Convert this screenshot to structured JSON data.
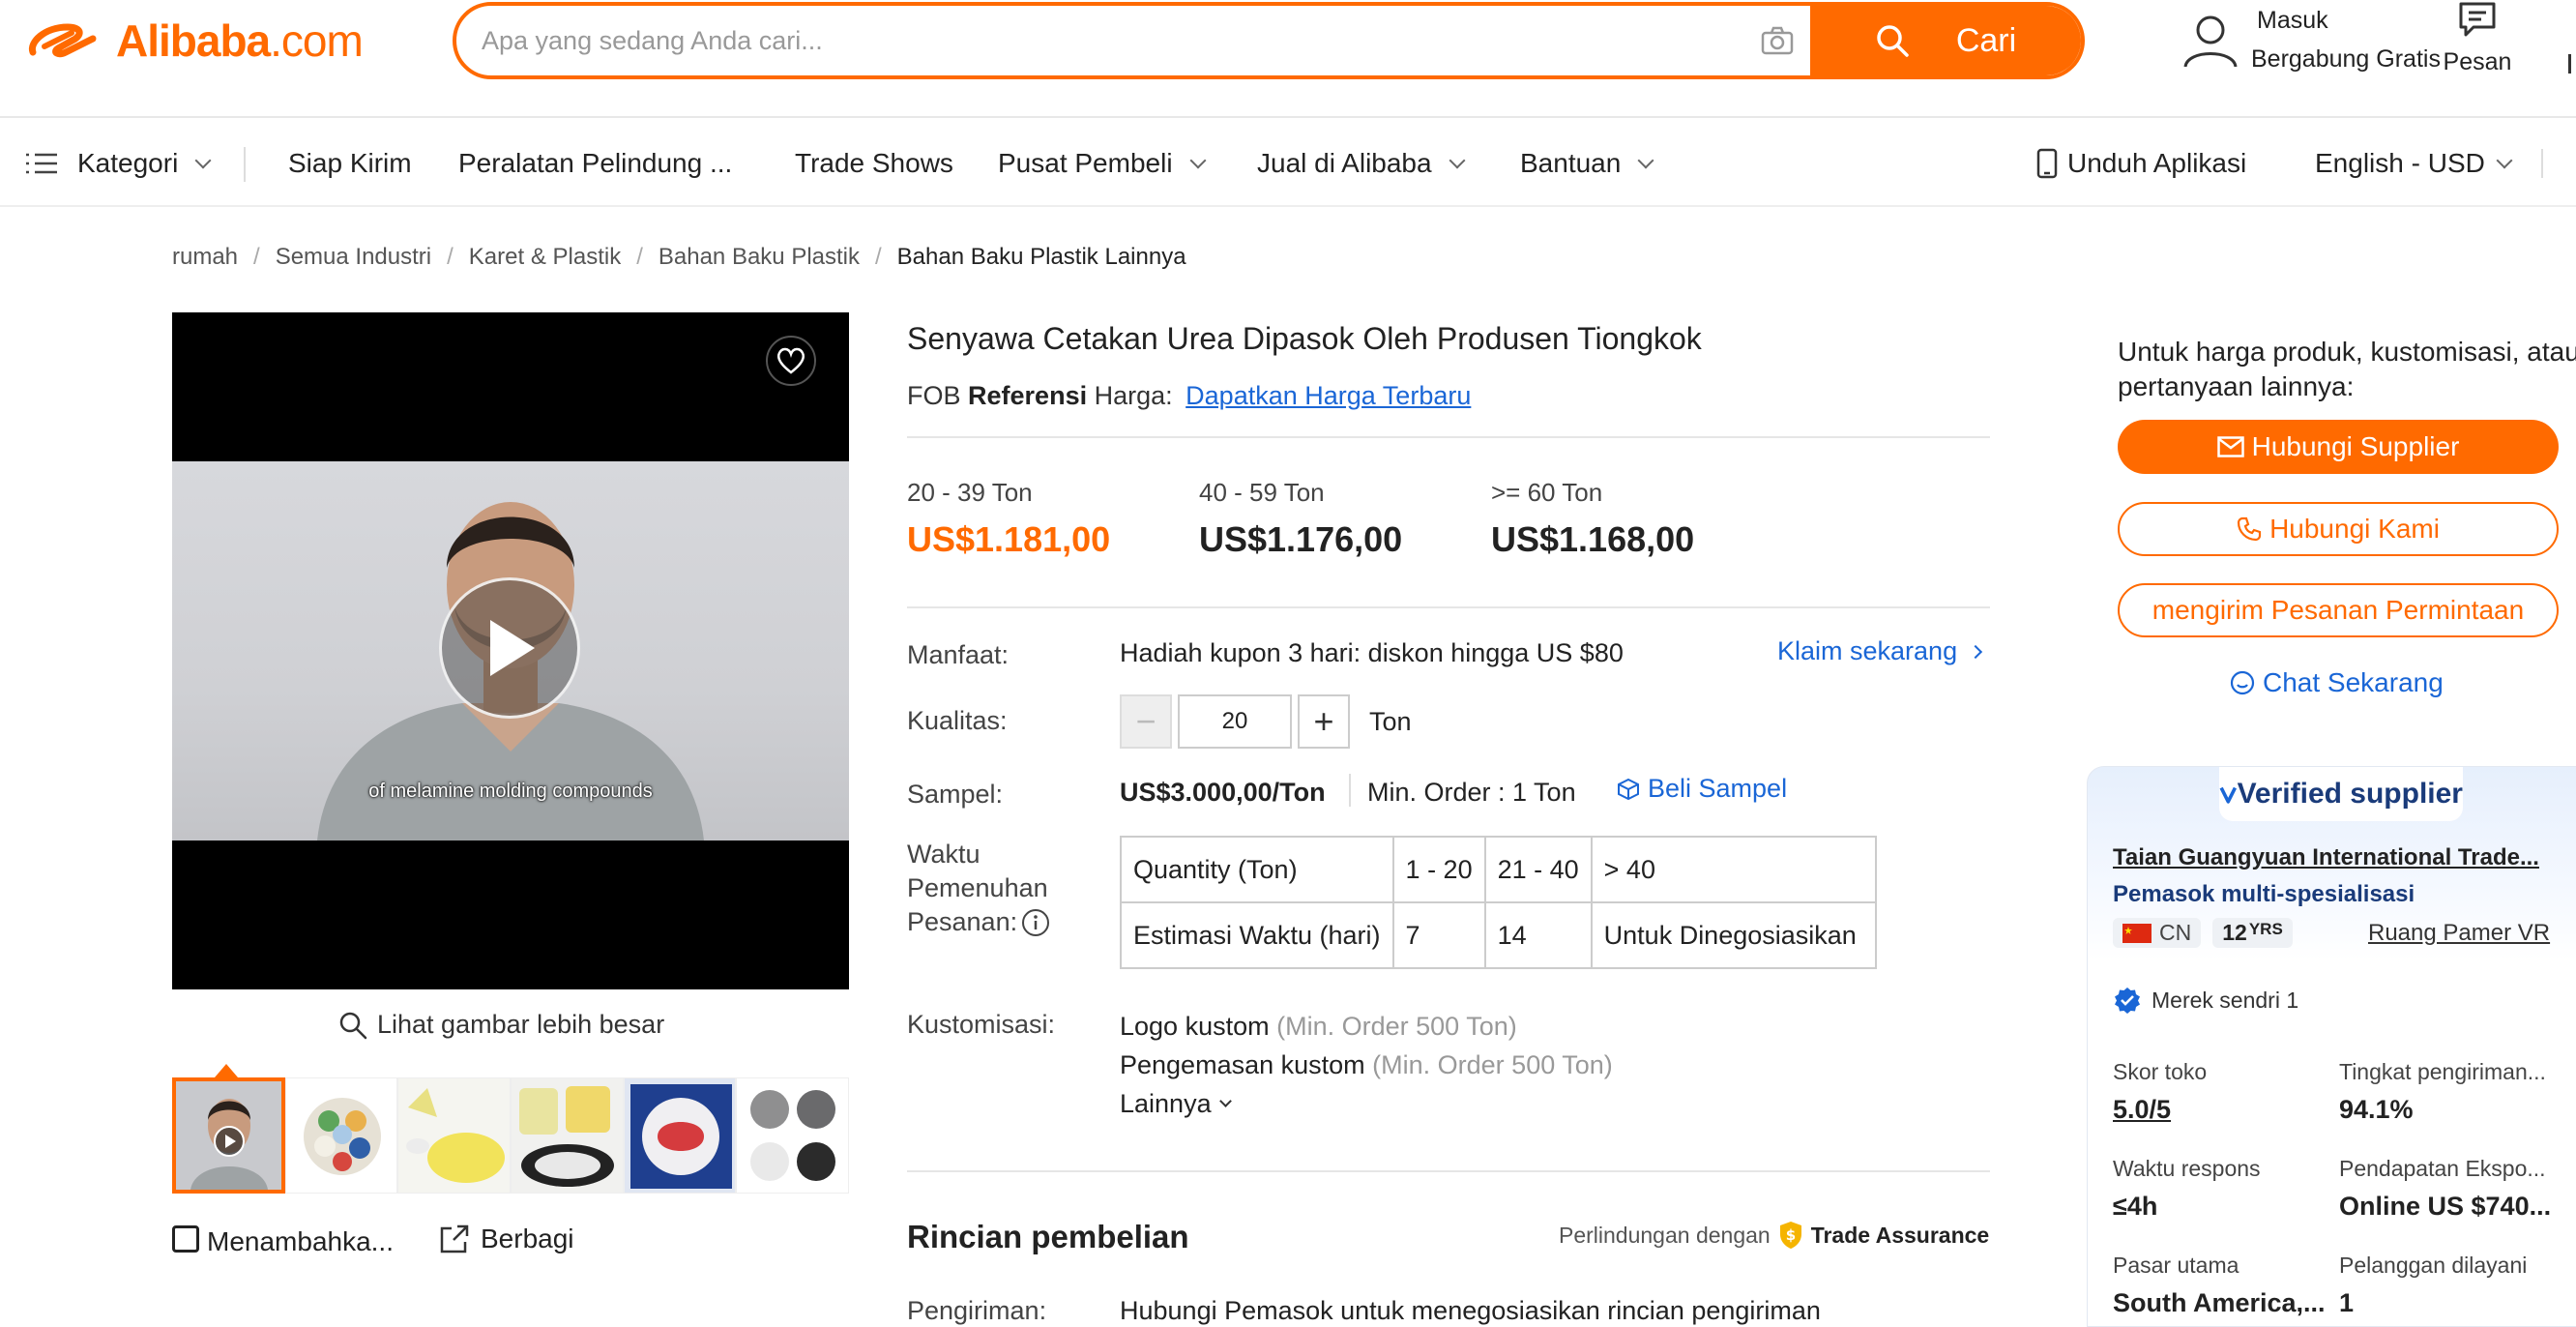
{
  "header": {
    "logo_text": "Alibaba",
    "logo_suffix": ".com",
    "search_placeholder": "Apa yang sedang Anda cari...",
    "search_button": "Cari",
    "signin": "Masuk",
    "join": "Bergabung Gratis",
    "messages": "Pesan"
  },
  "nav": {
    "categories": "Kategori",
    "items": [
      "Siap Kirim",
      "Peralatan Pelindung ...",
      "Trade Shows",
      "Pusat Pembeli",
      "Jual di Alibaba",
      "Bantuan"
    ],
    "app": "Unduh Aplikasi",
    "lang": "English - USD"
  },
  "breadcrumb": [
    "rumah",
    "Semua Industri",
    "Karet & Plastik",
    "Bahan Baku Plastik",
    "Bahan Baku Plastik Lainnya"
  ],
  "media": {
    "caption": "of melamine molding compounds",
    "zoom_label": "Lihat gambar lebih besar",
    "add_label": "Menambahka...",
    "share_label": "Berbagi"
  },
  "product": {
    "title": "Senyawa Cetakan Urea Dipasok Oleh Produsen Tiongkok",
    "fob_prefix": "FOB",
    "fob_ref": "Referensi",
    "fob_price_label": "Harga:",
    "fob_link": "Dapatkan Harga Terbaru",
    "tiers": [
      {
        "qty": "20 - 39 Ton",
        "price": "US$1.181,00"
      },
      {
        "qty": "40 - 59 Ton",
        "price": "US$1.176,00"
      },
      {
        "qty": ">= 60 Ton",
        "price": "US$1.168,00"
      }
    ],
    "benefit_label": "Manfaat:",
    "benefit_text": "Hadiah kupon 3 hari: diskon hingga US $80",
    "benefit_link": "Klaim sekarang",
    "quantity_label": "Kualitas:",
    "quantity_value": "20",
    "quantity_unit": "Ton",
    "sample_label": "Sampel:",
    "sample_price": "US$3.000,00/Ton",
    "sample_min": "Min. Order : 1 Ton",
    "sample_link": "Beli Sampel",
    "lead_label_1": "Waktu",
    "lead_label_2": "Pemenuhan",
    "lead_label_3": "Pesanan:",
    "lead_table": {
      "header": [
        "Quantity (Ton)",
        "1 - 20",
        "21 - 40",
        "> 40"
      ],
      "row": [
        "Estimasi Waktu (hari)",
        "7",
        "14",
        "Untuk Dinegosiasikan"
      ]
    },
    "custom_label": "Kustomisasi:",
    "custom_1": "Logo kustom",
    "custom_1_note": "(Min. Order 500 Ton)",
    "custom_2": "Pengemasan kustom",
    "custom_2_note": "(Min. Order 500 Ton)",
    "custom_more": "Lainnya",
    "purchase_heading": "Rincian pembelian",
    "protection_text": "Perlindungan dengan",
    "trade_assurance": "Trade Assurance",
    "shipping_label": "Pengiriman:",
    "shipping_text": "Hubungi Pemasok untuk menegosiasikan rincian pengiriman"
  },
  "sidebar": {
    "question": "Untuk harga produk, kustomisasi, atau pertanyaan lainnya:",
    "contact_supplier": "Hubungi Supplier",
    "call_us": "Hubungi Kami",
    "send_inquiry": "mengirim Pesanan Permintaan",
    "chat_now": "Chat Sekarang",
    "verified": "Verified supplier",
    "supplier_name": "Taian Guangyuan International Trade...",
    "supplier_type": "Pemasok multi-spesialisasi",
    "country": "CN",
    "years": "12",
    "years_unit": "YRS",
    "vr_link": "Ruang Pamer VR",
    "own_brand": "Merek sendri 1",
    "stats": [
      {
        "label": "Skor toko",
        "value": "5.0/5"
      },
      {
        "label": "Tingkat pengiriman...",
        "value": "94.1%"
      },
      {
        "label": "Waktu respons",
        "value": "≤4h"
      },
      {
        "label": "Pendapatan Ekspo...",
        "value": "Online US $740..."
      },
      {
        "label": "Pasar utama",
        "value": "South America,..."
      },
      {
        "label": "Pelanggan dilayani",
        "value": "1"
      }
    ]
  },
  "colors": {
    "brand": "#ff6a00",
    "link": "#1a66d6",
    "navy": "#1a3b7a"
  }
}
